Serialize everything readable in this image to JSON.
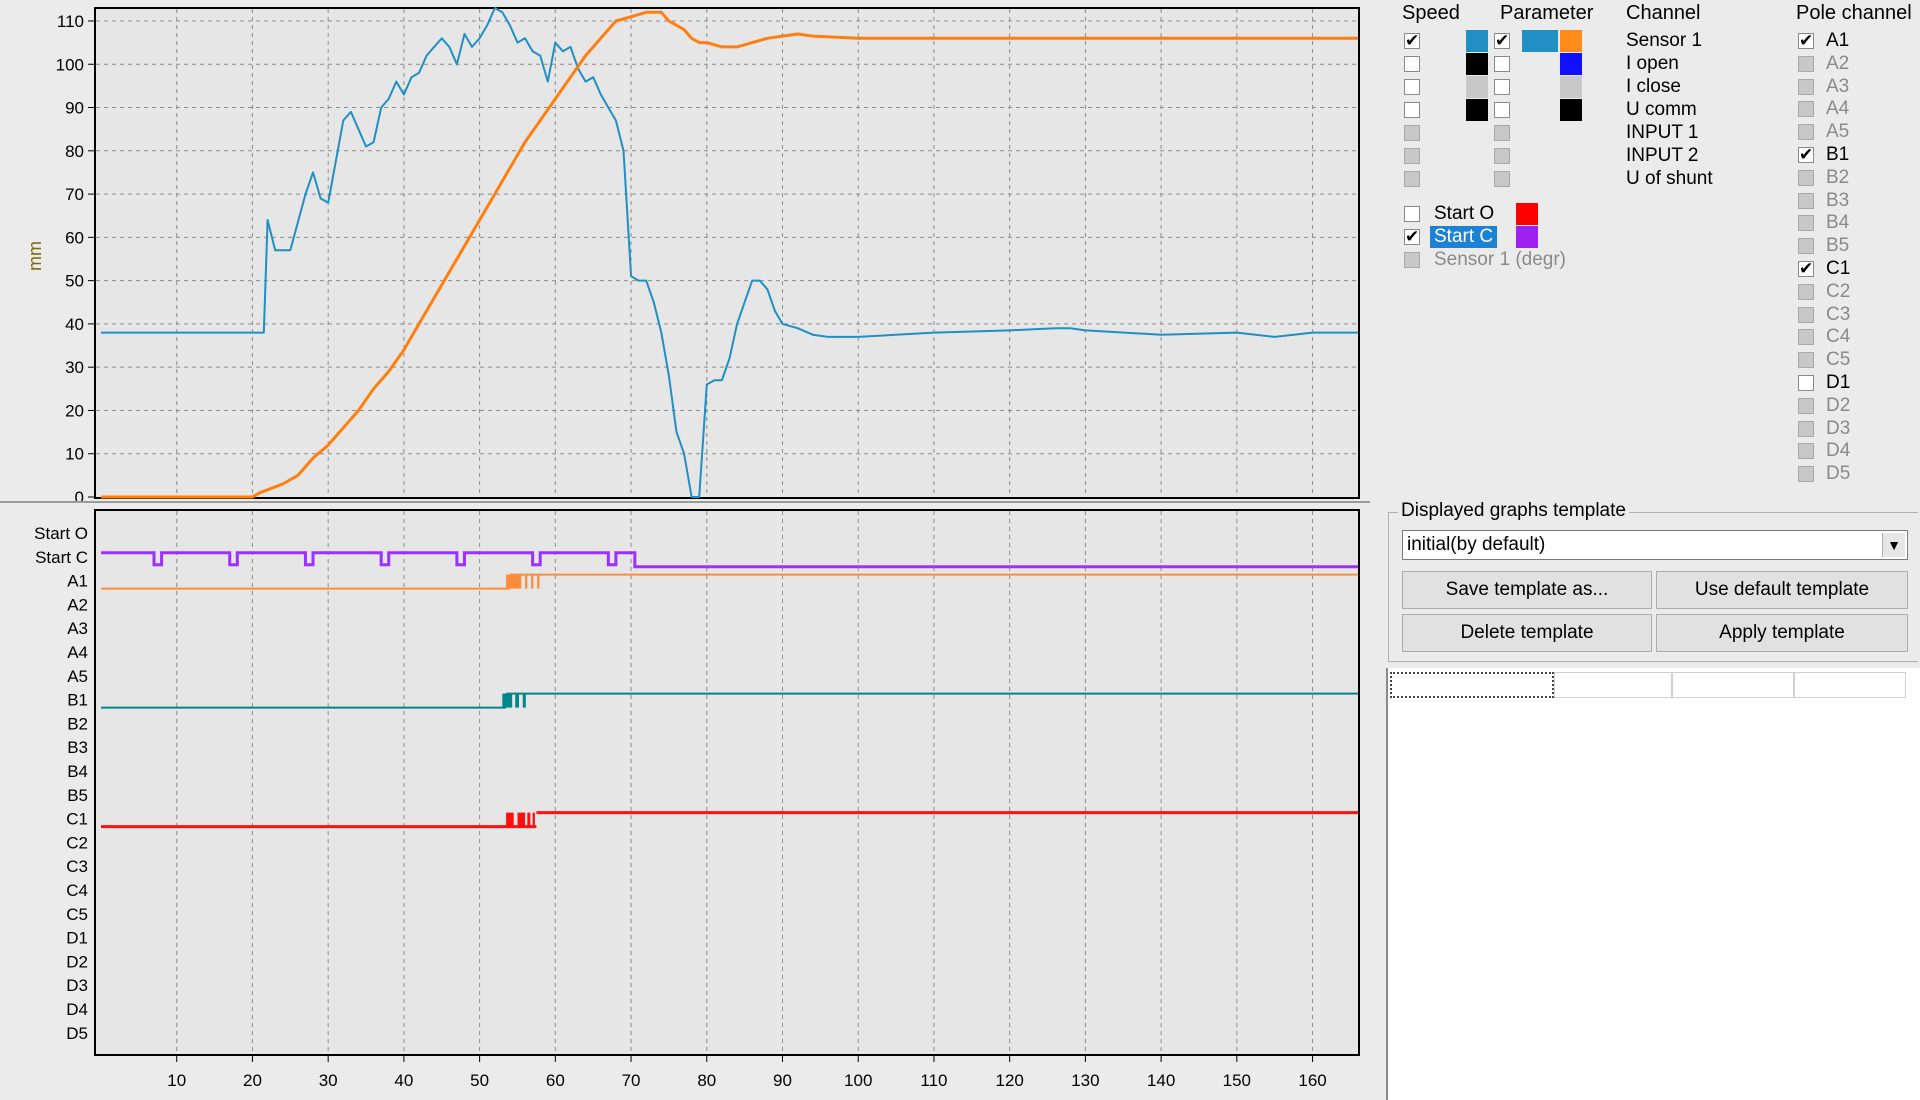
{
  "top_chart": {
    "ylabel": "mm",
    "y_ticks": [
      0,
      10,
      20,
      30,
      40,
      50,
      60,
      70,
      80,
      90,
      100,
      110
    ],
    "ylim": [
      0,
      113
    ],
    "xlim": [
      0,
      166
    ],
    "x_grid": [
      10,
      20,
      30,
      40,
      50,
      60,
      70,
      80,
      90,
      100,
      110,
      120,
      130,
      140,
      150,
      160
    ],
    "series": [
      {
        "color": "#1f8fc4",
        "points": [
          [
            0,
            38
          ],
          [
            21.5,
            38
          ],
          [
            22,
            64
          ],
          [
            23,
            57
          ],
          [
            25,
            57
          ],
          [
            27,
            70
          ],
          [
            28,
            75
          ],
          [
            29,
            69
          ],
          [
            30,
            68
          ],
          [
            32,
            87
          ],
          [
            33,
            89
          ],
          [
            35,
            81
          ],
          [
            36,
            82
          ],
          [
            37,
            90
          ],
          [
            38,
            92
          ],
          [
            39,
            96
          ],
          [
            40,
            93
          ],
          [
            41,
            97
          ],
          [
            42,
            98
          ],
          [
            43,
            102
          ],
          [
            44,
            104
          ],
          [
            45,
            106
          ],
          [
            46,
            104
          ],
          [
            47,
            100
          ],
          [
            48,
            107
          ],
          [
            49,
            104
          ],
          [
            50,
            106
          ],
          [
            51,
            109
          ],
          [
            52,
            113
          ],
          [
            53,
            112
          ],
          [
            54,
            109
          ],
          [
            55,
            105
          ],
          [
            56,
            106
          ],
          [
            57,
            103
          ],
          [
            58,
            102
          ],
          [
            59,
            96
          ],
          [
            60,
            105
          ],
          [
            61,
            103
          ],
          [
            62,
            104
          ],
          [
            63,
            99
          ],
          [
            64,
            96
          ],
          [
            65,
            97
          ],
          [
            66,
            93
          ],
          [
            67,
            90
          ],
          [
            68,
            87
          ],
          [
            69,
            80
          ],
          [
            70,
            51
          ],
          [
            71,
            50
          ],
          [
            72,
            50
          ],
          [
            73,
            45
          ],
          [
            74,
            38
          ],
          [
            75,
            28
          ],
          [
            76,
            15
          ],
          [
            77,
            10
          ],
          [
            78,
            0
          ],
          [
            79,
            0
          ],
          [
            80,
            26
          ],
          [
            81,
            27
          ],
          [
            82,
            27
          ],
          [
            83,
            32
          ],
          [
            84,
            40
          ],
          [
            85,
            45
          ],
          [
            86,
            50
          ],
          [
            87,
            50
          ],
          [
            88,
            48
          ],
          [
            89,
            43
          ],
          [
            90,
            40
          ],
          [
            92,
            39
          ],
          [
            94,
            37.5
          ],
          [
            96,
            37
          ],
          [
            100,
            37
          ],
          [
            110,
            38
          ],
          [
            120,
            38.5
          ],
          [
            126,
            39
          ],
          [
            128,
            39
          ],
          [
            130,
            38.5
          ],
          [
            140,
            37.5
          ],
          [
            150,
            38
          ],
          [
            155,
            37
          ],
          [
            160,
            38
          ],
          [
            166,
            38
          ]
        ]
      },
      {
        "color": "#ff7f0e",
        "points": [
          [
            0,
            0
          ],
          [
            20,
            0
          ],
          [
            21,
            1
          ],
          [
            24,
            3
          ],
          [
            26,
            5
          ],
          [
            28,
            9
          ],
          [
            30,
            12
          ],
          [
            32,
            16
          ],
          [
            34,
            20
          ],
          [
            36,
            25
          ],
          [
            38,
            29
          ],
          [
            40,
            34
          ],
          [
            42,
            40
          ],
          [
            44,
            46
          ],
          [
            46,
            52
          ],
          [
            48,
            58
          ],
          [
            50,
            64
          ],
          [
            52,
            70
          ],
          [
            54,
            76
          ],
          [
            56,
            82
          ],
          [
            58,
            87
          ],
          [
            60,
            92
          ],
          [
            62,
            97
          ],
          [
            64,
            102
          ],
          [
            66,
            106
          ],
          [
            68,
            110
          ],
          [
            70,
            111
          ],
          [
            72,
            112
          ],
          [
            74,
            112
          ],
          [
            75,
            110
          ],
          [
            77,
            108
          ],
          [
            78,
            106
          ],
          [
            79,
            105
          ],
          [
            80,
            105
          ],
          [
            82,
            104
          ],
          [
            84,
            104
          ],
          [
            86,
            105
          ],
          [
            88,
            106
          ],
          [
            90,
            106.5
          ],
          [
            92,
            107
          ],
          [
            94,
            106.5
          ],
          [
            100,
            106
          ],
          [
            105,
            106
          ],
          [
            110,
            106
          ],
          [
            120,
            106
          ],
          [
            130,
            106
          ],
          [
            140,
            106
          ],
          [
            150,
            106
          ],
          [
            160,
            106
          ],
          [
            166,
            106
          ]
        ]
      }
    ]
  },
  "bottom_chart": {
    "rows": [
      "Start O",
      "Start C",
      "A1",
      "A2",
      "A3",
      "A4",
      "A5",
      "B1",
      "B2",
      "B3",
      "B4",
      "B5",
      "C1",
      "C2",
      "C3",
      "C4",
      "C5",
      "D1",
      "D2",
      "D3",
      "D4",
      "D5"
    ],
    "x_ticks": [
      10,
      20,
      30,
      40,
      50,
      60,
      70,
      80,
      90,
      100,
      110,
      120,
      130,
      140,
      150,
      160
    ],
    "signals": [
      {
        "row": "Start C",
        "color": "#9b30ff",
        "switch_at": 70.5,
        "dips": [
          [
            7,
            8
          ],
          [
            17,
            18
          ],
          [
            27,
            28
          ],
          [
            37,
            38
          ],
          [
            47,
            48
          ],
          [
            57,
            58
          ],
          [
            67,
            68
          ]
        ]
      },
      {
        "row": "A1",
        "color": "#ff8c3a",
        "switch_at": 54,
        "bursts": [
          [
            53.5,
            55.5
          ],
          [
            56,
            56.3
          ],
          [
            56.8,
            57.1
          ],
          [
            57.6,
            57.9
          ]
        ]
      },
      {
        "row": "B1",
        "color": "#00868b",
        "switch_at": 53.5,
        "bursts": [
          [
            53,
            54.3
          ],
          [
            54.7,
            55.2
          ],
          [
            55.7,
            56.1
          ]
        ]
      },
      {
        "row": "C1",
        "color": "#ff1010",
        "switch_at": 57.5,
        "bursts": [
          [
            53.5,
            54.5
          ],
          [
            55,
            56
          ],
          [
            56.3,
            56.7
          ],
          [
            57,
            57.3
          ]
        ]
      }
    ]
  },
  "panel": {
    "headers": {
      "speed": "Speed",
      "parameter": "Parameter",
      "channel": "Channel",
      "pole_channel": "Pole channel"
    },
    "channels": [
      {
        "label": "Sensor 1",
        "speed_checked": true,
        "param_checked": true,
        "speed_color": "#1f8fc4",
        "param_color": "#1f8fc4",
        "param_color2": "#ff8c1a"
      },
      {
        "label": "I open",
        "speed_checked": false,
        "param_checked": false,
        "speed_color": "#000000",
        "param_color": "",
        "param_color2": "#1010ff"
      },
      {
        "label": "I close",
        "speed_checked": false,
        "param_checked": false,
        "speed_color": "#c8c8c8",
        "param_color": "",
        "param_color2": "#c8c8c8"
      },
      {
        "label": "U comm",
        "speed_checked": false,
        "param_checked": false,
        "speed_color": "#000000",
        "param_color": "",
        "param_color2": "#000000"
      },
      {
        "label": "INPUT 1",
        "speed_checked": false,
        "param_checked": false,
        "speed_color": "",
        "param_color": "",
        "param_color2": "",
        "disabled": true
      },
      {
        "label": "INPUT 2",
        "speed_checked": false,
        "param_checked": false,
        "speed_color": "",
        "param_color": "",
        "param_color2": "",
        "disabled": true
      },
      {
        "label": "U of shunt",
        "speed_checked": false,
        "param_checked": false,
        "speed_color": "",
        "param_color": "",
        "param_color2": "",
        "disabled": true
      }
    ],
    "starts": [
      {
        "label": "Start O",
        "checked": false,
        "color": "#ff0000",
        "selected": false,
        "disabled": false
      },
      {
        "label": "Start C",
        "checked": true,
        "color": "#a020f0",
        "selected": true,
        "disabled": false
      },
      {
        "label": "Sensor 1 (degr)",
        "checked": false,
        "color": "",
        "selected": false,
        "disabled": true
      }
    ],
    "pole_channels": [
      {
        "label": "A1",
        "checked": true,
        "enabled": true
      },
      {
        "label": "A2",
        "checked": false,
        "enabled": false
      },
      {
        "label": "A3",
        "checked": false,
        "enabled": false
      },
      {
        "label": "A4",
        "checked": false,
        "enabled": false
      },
      {
        "label": "A5",
        "checked": false,
        "enabled": false
      },
      {
        "label": "B1",
        "checked": true,
        "enabled": true
      },
      {
        "label": "B2",
        "checked": false,
        "enabled": false
      },
      {
        "label": "B3",
        "checked": false,
        "enabled": false
      },
      {
        "label": "B4",
        "checked": false,
        "enabled": false
      },
      {
        "label": "B5",
        "checked": false,
        "enabled": false
      },
      {
        "label": "C1",
        "checked": true,
        "enabled": true
      },
      {
        "label": "C2",
        "checked": false,
        "enabled": false
      },
      {
        "label": "C3",
        "checked": false,
        "enabled": false
      },
      {
        "label": "C4",
        "checked": false,
        "enabled": false
      },
      {
        "label": "C5",
        "checked": false,
        "enabled": false
      },
      {
        "label": "D1",
        "checked": false,
        "enabled": true
      },
      {
        "label": "D2",
        "checked": false,
        "enabled": false
      },
      {
        "label": "D3",
        "checked": false,
        "enabled": false
      },
      {
        "label": "D4",
        "checked": false,
        "enabled": false
      },
      {
        "label": "D5",
        "checked": false,
        "enabled": false
      }
    ],
    "template": {
      "title": "Displayed graphs template",
      "selected": "initial(by default)",
      "save_label": "Save template as...",
      "use_default_label": "Use default template",
      "delete_label": "Delete template",
      "apply_label": "Apply template"
    }
  }
}
